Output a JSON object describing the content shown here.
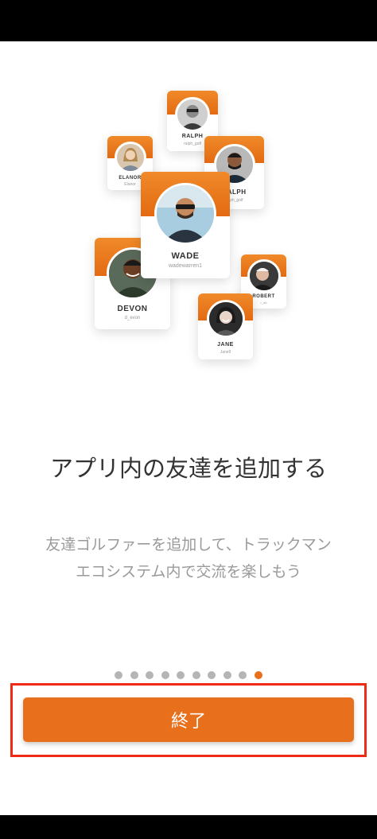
{
  "cards": [
    {
      "id": "ralph1",
      "name": "RALPH",
      "handle": "ralph_golf"
    },
    {
      "id": "elanor",
      "name": "ELANOR",
      "handle": "Elanor"
    },
    {
      "id": "ralph2",
      "name": "RALPH",
      "handle": "ralph_golf"
    },
    {
      "id": "wade",
      "name": "WADE",
      "handle": "wadewarren1"
    },
    {
      "id": "robert",
      "name": "ROBERT",
      "handle": "r_ob"
    },
    {
      "id": "devon",
      "name": "DEVON",
      "handle": "d_evon"
    },
    {
      "id": "jane",
      "name": "JANE",
      "handle": "Jane9"
    }
  ],
  "onboarding": {
    "title": "アプリ内の友達を追加する",
    "subtitle_line1": "友達ゴルファーを追加して、トラックマン",
    "subtitle_line2": "エコシステム内で交流を楽しもう"
  },
  "pagination": {
    "total": 10,
    "current": 10
  },
  "button": {
    "finish_label": "終了"
  },
  "colors": {
    "accent": "#e8701c",
    "highlight": "#ef2a16"
  }
}
